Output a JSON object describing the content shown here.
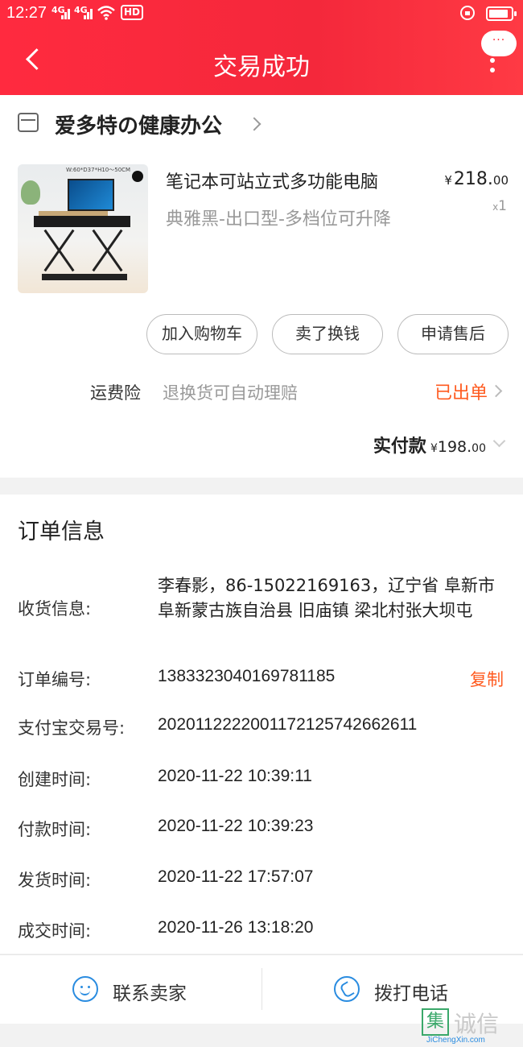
{
  "status_bar": {
    "time": "12:27",
    "network1": "4G",
    "network2": "4G",
    "hd": "HD",
    "battery_level": 0.9
  },
  "header": {
    "title": "交易成功"
  },
  "shop": {
    "name": "爱多特の健康办公"
  },
  "product": {
    "name": "笔记本可站立式多功能电脑",
    "spec": "典雅黑-出口型-多档位可升降",
    "currency": "¥",
    "price_int": "218.",
    "price_dec": "00",
    "qty_prefix": "x",
    "qty": "1",
    "image_tag": "W:60*D37*H10～50CM"
  },
  "actions": {
    "add_cart": "加入购物车",
    "resell": "卖了换钱",
    "after_sale": "申请售后"
  },
  "insurance": {
    "label": "运费险",
    "desc": "退换货可自动理赔",
    "status": "已出单"
  },
  "payment": {
    "label": "实付款",
    "currency": "¥",
    "amount_int": "198.",
    "amount_dec": "00"
  },
  "order_info": {
    "title": "订单信息",
    "address_label": "收货信息:",
    "address": "李春影，86-15022169163，辽宁省 阜新市 阜新蒙古族自治县 旧庙镇 梁北村张大坝屯",
    "order_no_label": "订单编号:",
    "order_no": "1383323040169781185",
    "copy": "复制",
    "alipay_label": "支付宝交易号:",
    "alipay_no": "2020112222001172125742662611",
    "created_label": "创建时间:",
    "created": "2020-11-22 10:39:11",
    "paid_label": "付款时间:",
    "paid": "2020-11-22 10:39:23",
    "shipped_label": "发货时间:",
    "shipped": "2020-11-22 17:57:07",
    "closed_label": "成交时间:",
    "closed": "2020-11-26 13:18:20"
  },
  "bottom": {
    "contact": "联系卖家",
    "call": "拨打电话"
  },
  "watermark": {
    "box": "集",
    "text": "诚信",
    "sub": "JiChengXin.com"
  },
  "colors": {
    "header_red": "#f4283b",
    "accent_orange": "#ff5a1f",
    "icon_blue": "#2a8ce0"
  }
}
